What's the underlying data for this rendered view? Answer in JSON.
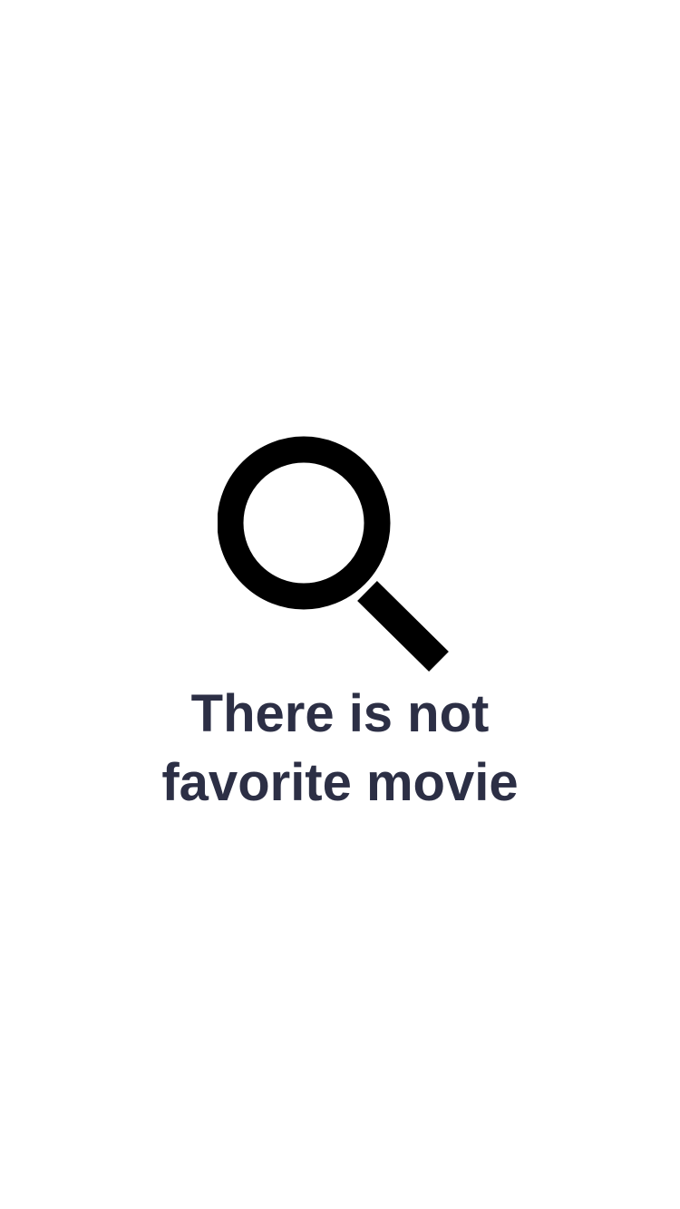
{
  "empty_state": {
    "icon": "search-icon",
    "message": "There is not favorite movie"
  },
  "colors": {
    "background": "#ffffff",
    "icon": "#000000",
    "text": "#2c2f45"
  }
}
